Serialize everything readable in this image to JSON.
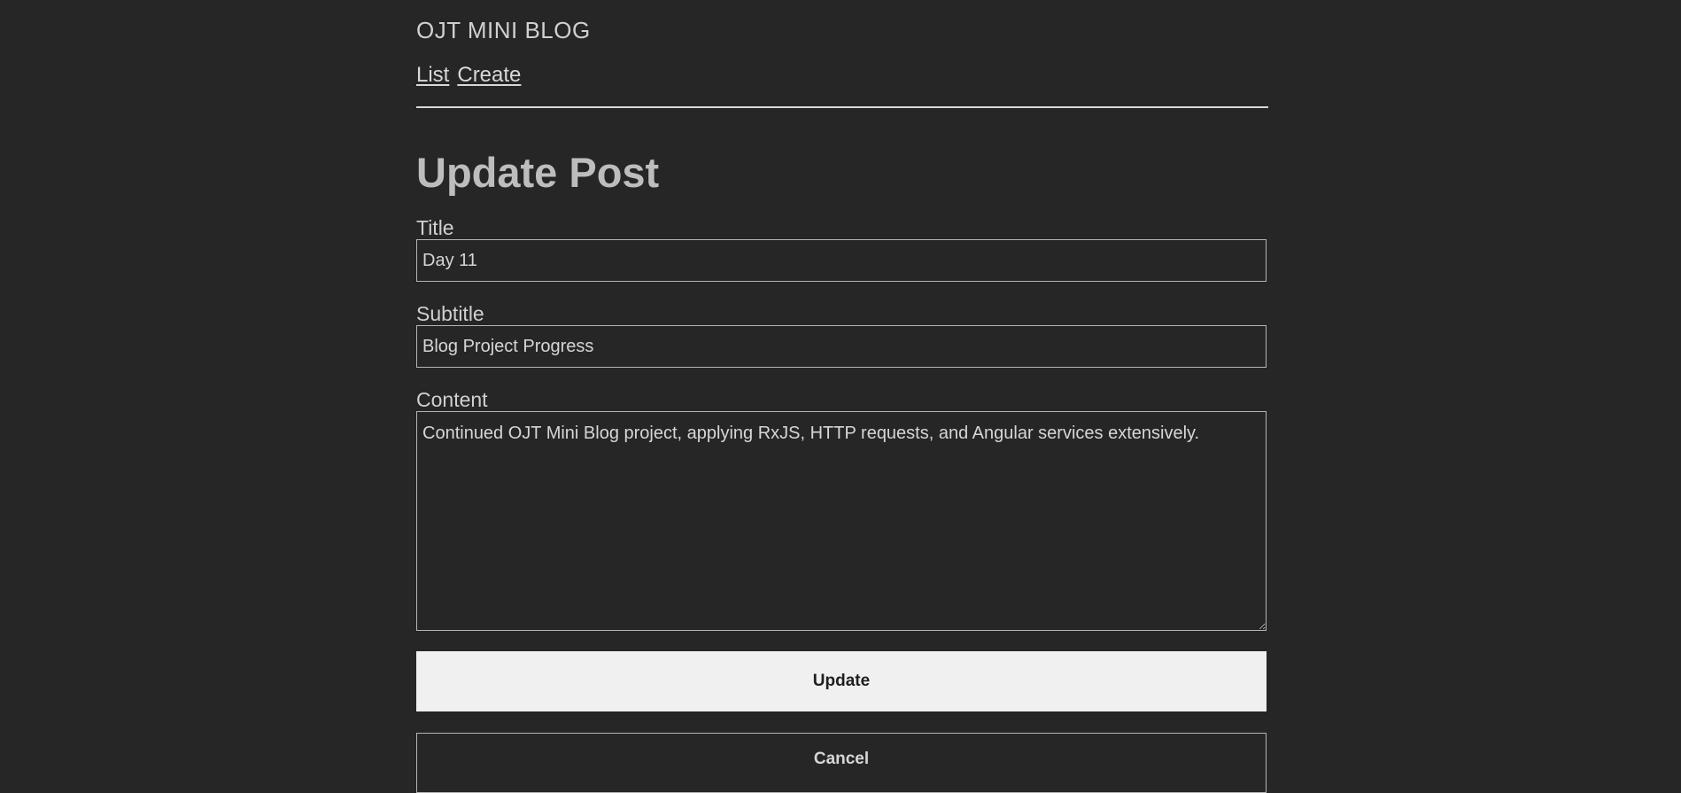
{
  "header": {
    "brand": "OJT MINI BLOG",
    "nav": [
      {
        "label": "List"
      },
      {
        "label": "Create"
      }
    ]
  },
  "page": {
    "title": "Update Post"
  },
  "form": {
    "title_label": "Title",
    "title_value": "Day 11",
    "subtitle_label": "Subtitle",
    "subtitle_value": "Blog Project Progress",
    "content_label": "Content",
    "content_value": "Continued OJT Mini Blog project, applying RxJS, HTTP requests, and Angular services extensively.",
    "update_label": "Update",
    "cancel_label": "Cancel"
  }
}
